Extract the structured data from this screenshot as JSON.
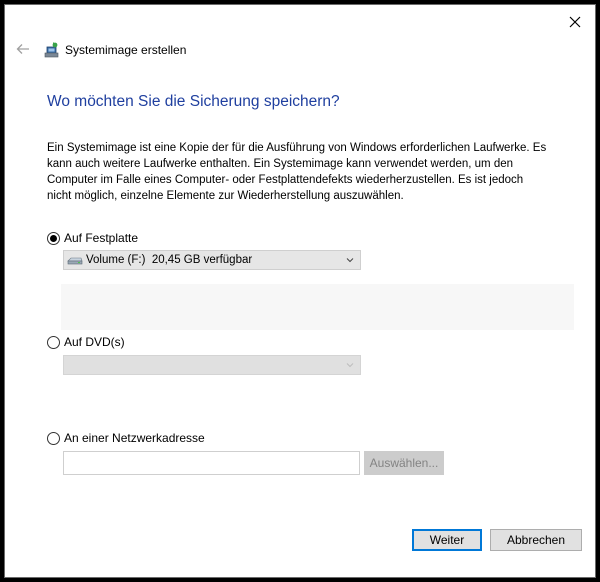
{
  "window": {
    "title": "Systemimage erstellen",
    "close_glyph": "✕"
  },
  "heading": "Wo möchten Sie die Sicherung speichern?",
  "description": "Ein Systemimage ist eine Kopie der für die Ausführung von Windows erforderlichen Laufwerke. Es kann auch weitere Laufwerke enthalten. Ein Systemimage kann verwendet werden, um den Computer im Falle eines Computer- oder Festplattendefekts wiederherzustellen. Es ist jedoch nicht möglich, einzelne Elemente zur Wiederherstellung auszuwählen.",
  "options": {
    "harddisk": {
      "label": "Auf Festplatte",
      "selected": true,
      "drive_value": "Volume (F:)  20,45 GB verfügbar"
    },
    "dvd": {
      "label": "Auf DVD(s)",
      "selected": false,
      "drive_value": ""
    },
    "network": {
      "label": "An einer Netzwerkadresse",
      "selected": false,
      "path_value": "",
      "browse_label": "Auswählen..."
    }
  },
  "footer": {
    "next_label": "Weiter",
    "cancel_label": "Abbrechen"
  },
  "colors": {
    "heading": "#1f3f9f",
    "primary_border": "#0078d7"
  },
  "icons": {
    "close": "close-icon",
    "back": "back-arrow-icon",
    "title": "backup-icon",
    "drive": "drive-icon",
    "dropdown": "chevron-down-icon"
  }
}
